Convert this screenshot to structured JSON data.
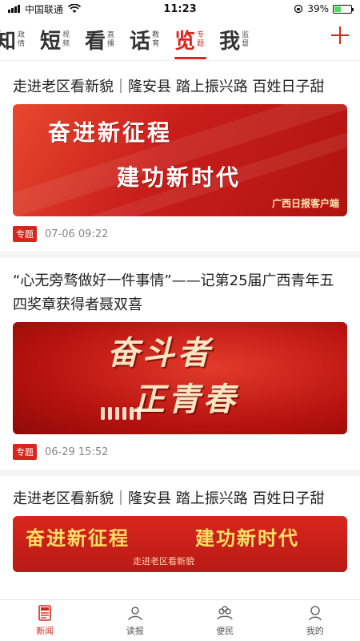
{
  "status_bar": {
    "carrier": "中国联通",
    "time": "11:23",
    "battery": "39%",
    "battery_level": 0.39
  },
  "channels": [
    {
      "big": "知",
      "sub": "政情",
      "active": false
    },
    {
      "big": "短",
      "sub": "视频",
      "active": false
    },
    {
      "big": "看",
      "sub": "直播",
      "active": false
    },
    {
      "big": "话",
      "sub": "教育",
      "active": false
    },
    {
      "big": "览",
      "sub": "专题",
      "active": true
    },
    {
      "big": "我",
      "sub": "监督",
      "active": false
    }
  ],
  "articles": [
    {
      "title": "走进老区看新貌｜隆安县 踏上振兴路 百姓日子甜",
      "cover": {
        "line1": "奋进新征程",
        "line2": "建功新时代",
        "brand": "广西日报客户端"
      },
      "tag": "专题",
      "time": "07-06 09:22"
    },
    {
      "title": "“心无旁骛做好一件事情”——记第25届广西青年五四奖章获得者聂双喜",
      "cover": {
        "line1": "奋斗者",
        "line2": "正青春"
      },
      "tag": "专题",
      "time": "06-29 15:52"
    },
    {
      "title": "走进老区看新貌｜隆安县 踏上振兴路 百姓日子甜",
      "cover": {
        "line1": "奋进新征程",
        "line2": "建功新时代",
        "small": "走进老区看新貌"
      }
    }
  ],
  "tabs": [
    {
      "label": "新闻",
      "icon": "news-icon",
      "active": true
    },
    {
      "label": "读报",
      "icon": "reader-icon",
      "active": false
    },
    {
      "label": "便民",
      "icon": "community-icon",
      "active": false
    },
    {
      "label": "我的",
      "icon": "profile-icon",
      "active": false
    }
  ],
  "colors": {
    "accent": "#d8261e",
    "battery": "#4cd964"
  }
}
